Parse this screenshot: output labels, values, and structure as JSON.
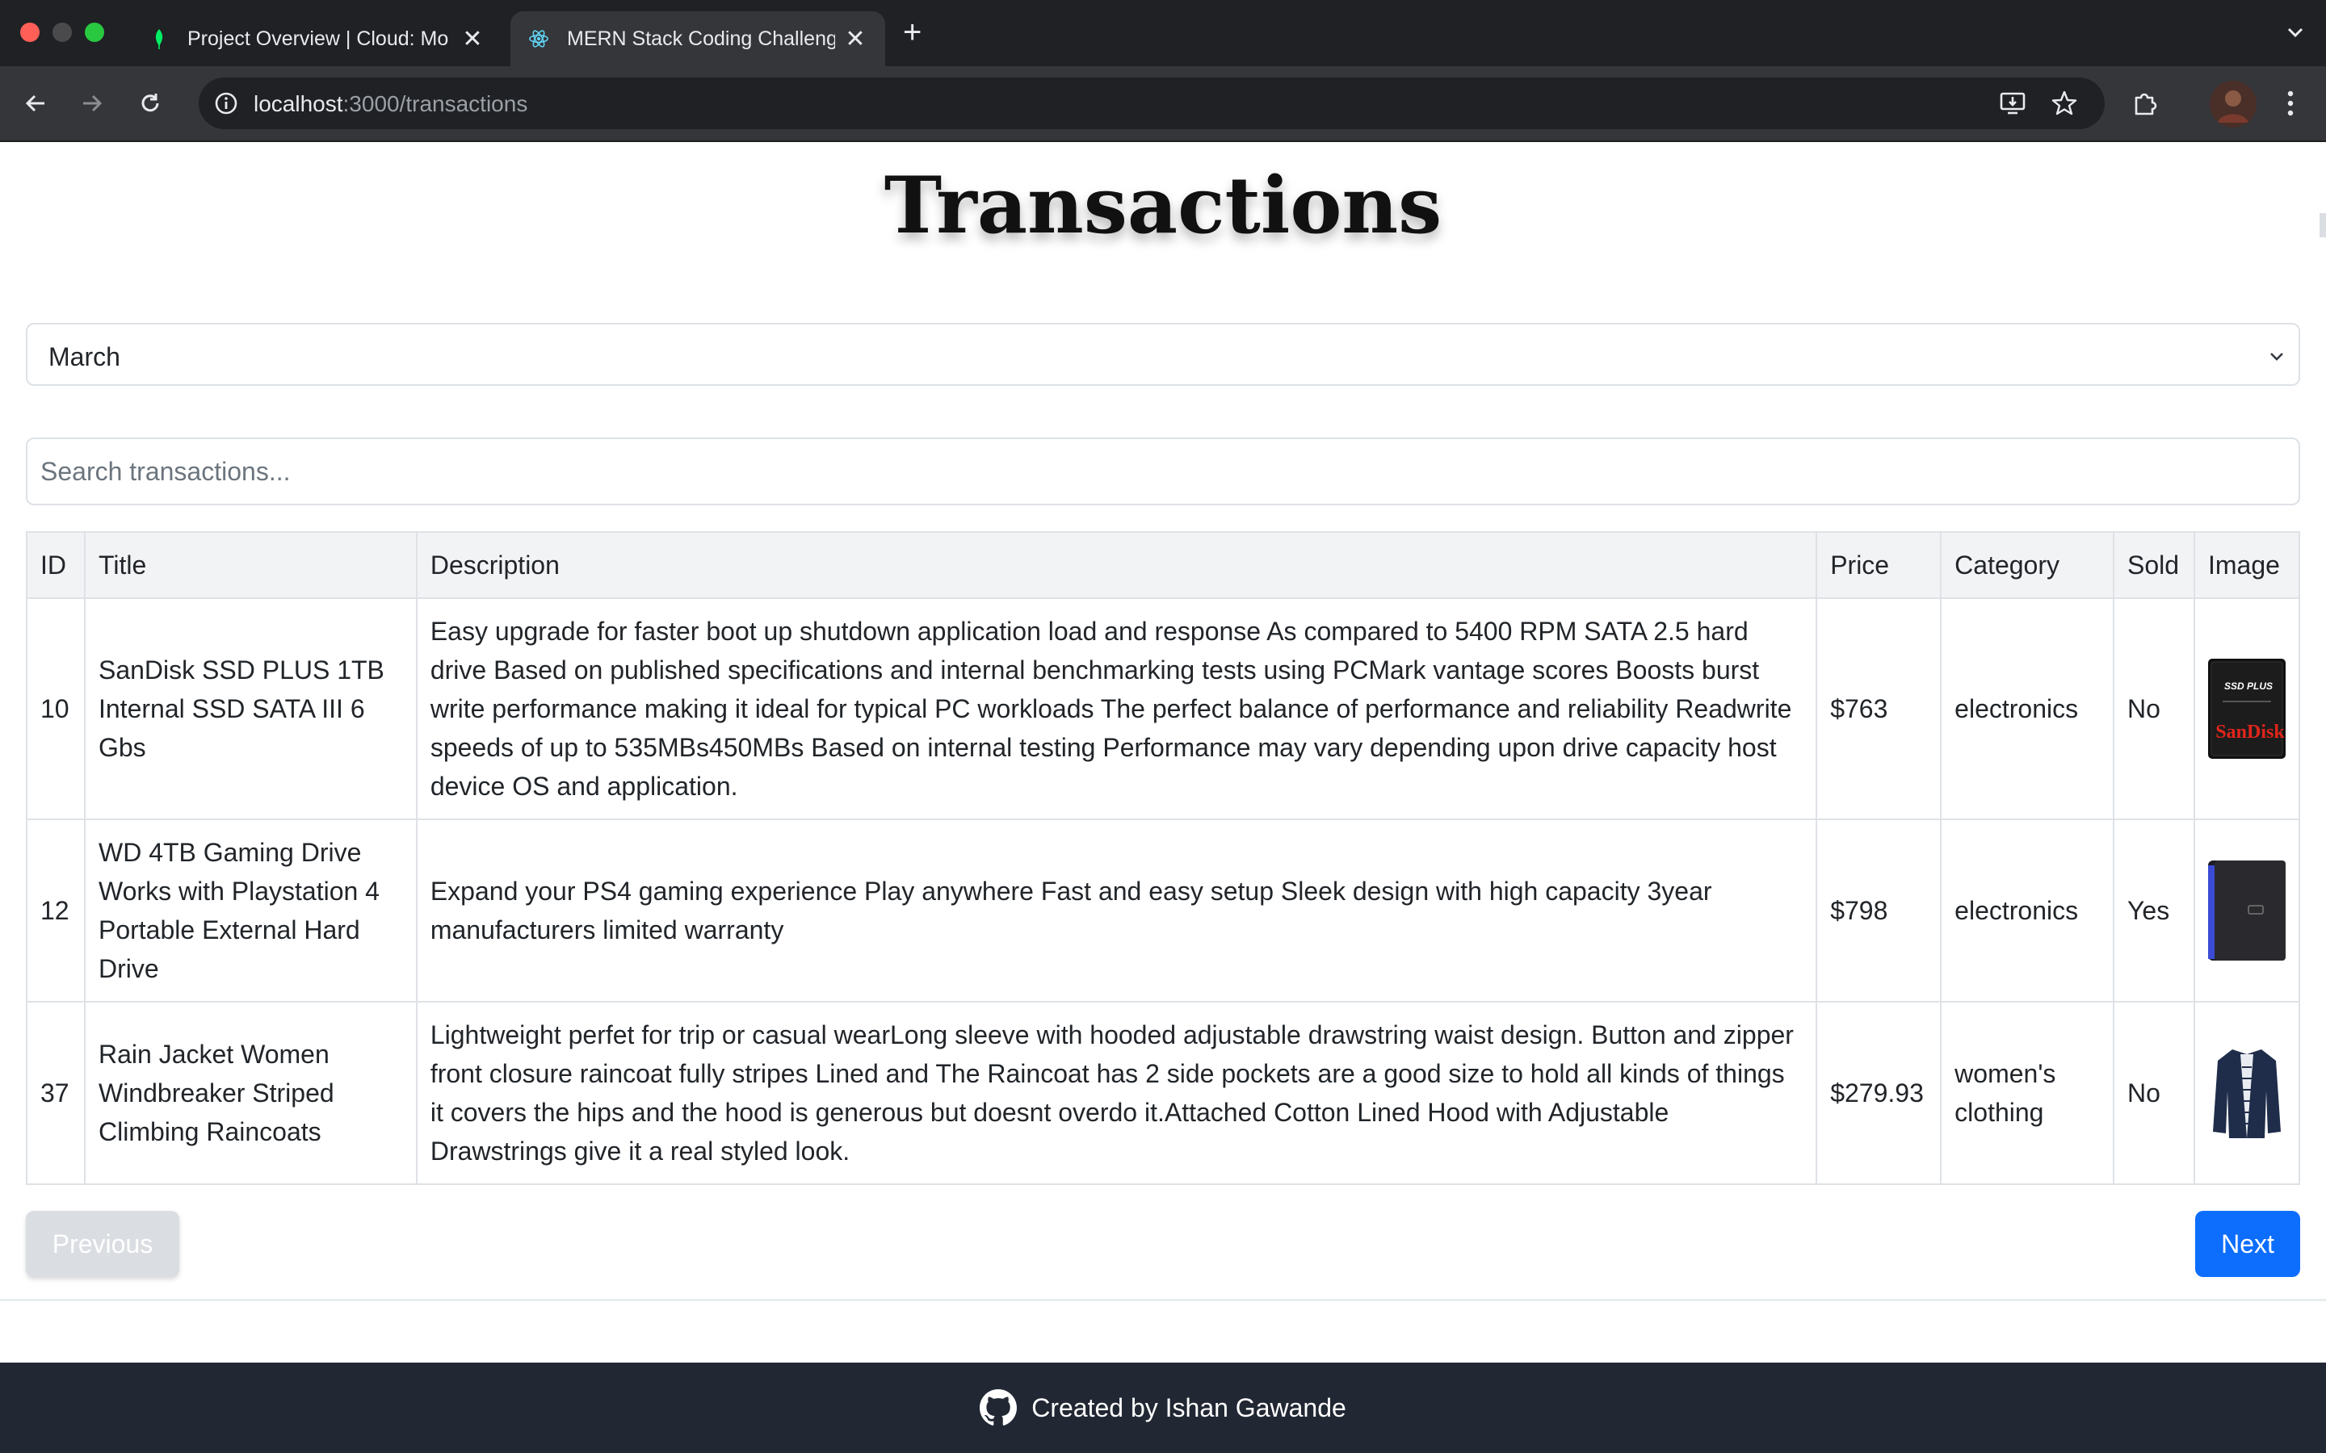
{
  "browser": {
    "tabs": [
      {
        "title": "Project Overview | Cloud: Mo",
        "favicon": "mongodb-leaf-icon",
        "active": false
      },
      {
        "title": "MERN Stack Coding Challeng",
        "favicon": "react-icon",
        "active": true
      }
    ],
    "url_host": "localhost",
    "url_path": ":3000/transactions"
  },
  "page": {
    "title": "Transactions",
    "month_filter": {
      "selected": "March"
    },
    "search": {
      "placeholder": "Search transactions...",
      "value": ""
    },
    "table": {
      "headers": {
        "id": "ID",
        "title": "Title",
        "description": "Description",
        "price": "Price",
        "category": "Category",
        "sold": "Sold",
        "image": "Image"
      },
      "rows": [
        {
          "id": "10",
          "title": "SanDisk SSD PLUS 1TB Internal SSD SATA III 6 Gbs",
          "description": "Easy upgrade for faster boot up shutdown application load and response As compared to 5400 RPM SATA 2.5 hard drive Based on published specifications and internal benchmarking tests using PCMark vantage scores Boosts burst write performance making it ideal for typical PC workloads The perfect balance of performance and reliability Readwrite speeds of up to 535MBs450MBs Based on internal testing Performance may vary depending upon drive capacity host device OS and application.",
          "price": "$763",
          "category": "electronics",
          "sold": "No",
          "image_label_1": "SSD PLUS",
          "image_label_2": "SanDisk"
        },
        {
          "id": "12",
          "title": "WD 4TB Gaming Drive Works with Playstation 4 Portable External Hard Drive",
          "description": "Expand your PS4 gaming experience Play anywhere Fast and easy setup Sleek design with high capacity 3year manufacturers limited warranty",
          "price": "$798",
          "category": "electronics",
          "sold": "Yes"
        },
        {
          "id": "37",
          "title": "Rain Jacket Women Windbreaker Striped Climbing Raincoats",
          "description": "Lightweight perfet for trip or casual wearLong sleeve with hooded adjustable drawstring waist design. Button and zipper front closure raincoat fully stripes Lined and The Raincoat has 2 side pockets are a good size to hold all kinds of things it covers the hips and the hood is generous but doesnt overdo it.Attached Cotton Lined Hood with Adjustable Drawstrings give it a real styled look.",
          "price": "$279.93",
          "category": "women's clothing",
          "sold": "No"
        }
      ]
    },
    "pagination": {
      "previous_label": "Previous",
      "next_label": "Next"
    },
    "footer": {
      "text": "Created by Ishan Gawande"
    }
  },
  "colors": {
    "primary": "#0d6efd",
    "footer_bg": "#212733",
    "chrome_bg": "#202124"
  }
}
